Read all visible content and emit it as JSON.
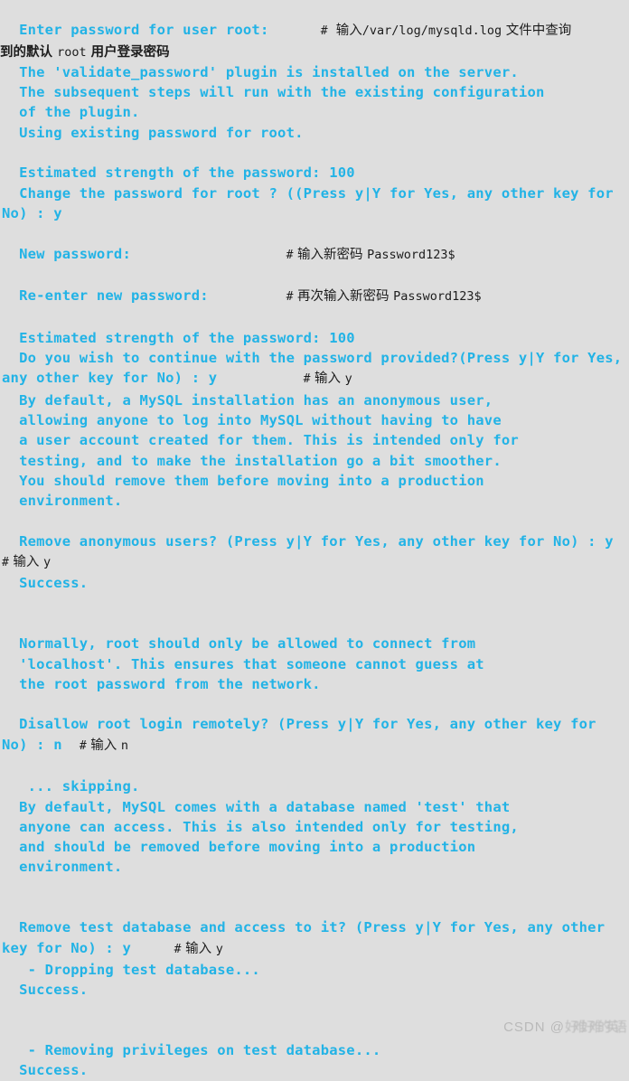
{
  "terminal": {
    "background_color": "#dedede",
    "text_color": "#22b3e6",
    "annotation_color": "#1d1d1d",
    "lines": [
      {
        "id": "l00",
        "type": "blank",
        "text": " "
      },
      {
        "id": "l01",
        "type": "out-note",
        "text": "  Enter password for user root:",
        "note_hash": "#",
        "note_cn": "  输入",
        "note_mono": "/var/log/mysqld.log",
        "note_cn2": " 文件中查询"
      },
      {
        "id": "l02",
        "type": "cn",
        "cn": "到的默认 ",
        "mono": "root",
        "cn2": " 用户登录密码"
      },
      {
        "id": "l03",
        "type": "out",
        "text": "  The 'validate_password' plugin is installed on the server."
      },
      {
        "id": "l04",
        "type": "out",
        "text": "  The subsequent steps will run with the existing configuration"
      },
      {
        "id": "l05",
        "type": "out",
        "text": "  of the plugin."
      },
      {
        "id": "l06",
        "type": "out",
        "text": "  Using existing password for root."
      },
      {
        "id": "l07",
        "type": "blank",
        "text": " "
      },
      {
        "id": "l08",
        "type": "out",
        "text": "  Estimated strength of the password: 100"
      },
      {
        "id": "l09",
        "type": "out",
        "text": "  Change the password for root ? ((Press y|Y for Yes, any other key for No) : y"
      },
      {
        "id": "l10",
        "type": "blank",
        "text": " "
      },
      {
        "id": "l11",
        "type": "out-note",
        "text": "  New password:",
        "note_pad": "                  ",
        "note_hash": "#",
        "note_cn": " 输入新密码 ",
        "note_mono": "Password123$",
        "note_cn2": ""
      },
      {
        "id": "l12",
        "type": "blank",
        "text": " "
      },
      {
        "id": "l13",
        "type": "out-note",
        "text": "  Re-enter new password:",
        "note_pad": "         ",
        "note_hash": "#",
        "note_cn": " 再次输入新密码 ",
        "note_mono": "Password123$",
        "note_cn2": ""
      },
      {
        "id": "l14",
        "type": "blank",
        "text": " "
      },
      {
        "id": "l15",
        "type": "out",
        "text": "  Estimated strength of the password: 100"
      },
      {
        "id": "l16",
        "type": "out-note",
        "text": "  Do you wish to continue with the password provided?(Press y|Y for Yes, any other key for No) : y",
        "note_pad": "          ",
        "note_hash": "#",
        "note_cn": " 输入 ",
        "note_mono": "y",
        "note_cn2": ""
      },
      {
        "id": "l17",
        "type": "out",
        "text": "  By default, a MySQL installation has an anonymous user,"
      },
      {
        "id": "l18",
        "type": "out",
        "text": "  allowing anyone to log into MySQL without having to have"
      },
      {
        "id": "l19",
        "type": "out",
        "text": "  a user account created for them. This is intended only for"
      },
      {
        "id": "l20",
        "type": "out",
        "text": "  testing, and to make the installation go a bit smoother."
      },
      {
        "id": "l21",
        "type": "out",
        "text": "  You should remove them before moving into a production"
      },
      {
        "id": "l22",
        "type": "out",
        "text": "  environment."
      },
      {
        "id": "l23",
        "type": "blank",
        "text": " "
      },
      {
        "id": "l24",
        "type": "out-note",
        "text": "  Remove anonymous users? (Press y|Y for Yes, any other key for No) : y",
        "note_pad": "    ",
        "note_hash": "#",
        "note_cn": " 输入 ",
        "note_mono": "y",
        "note_cn2": ""
      },
      {
        "id": "l25",
        "type": "out",
        "text": "  Success."
      },
      {
        "id": "l26",
        "type": "blank",
        "text": " "
      },
      {
        "id": "l27",
        "type": "blank",
        "text": " "
      },
      {
        "id": "l28",
        "type": "out",
        "text": "  Normally, root should only be allowed to connect from"
      },
      {
        "id": "l29",
        "type": "out",
        "text": "  'localhost'. This ensures that someone cannot guess at"
      },
      {
        "id": "l30",
        "type": "out",
        "text": "  the root password from the network."
      },
      {
        "id": "l31",
        "type": "blank",
        "text": " "
      },
      {
        "id": "l32",
        "type": "out-note",
        "text": "  Disallow root login remotely? (Press y|Y for Yes, any other key for No) : n",
        "note_pad": "  ",
        "note_hash": "#",
        "note_cn": " 输入 ",
        "note_mono": "n",
        "note_cn2": ""
      },
      {
        "id": "l33",
        "type": "blank",
        "text": " "
      },
      {
        "id": "l34",
        "type": "out",
        "text": "   ... skipping."
      },
      {
        "id": "l35",
        "type": "out",
        "text": "  By default, MySQL comes with a database named 'test' that"
      },
      {
        "id": "l36",
        "type": "out",
        "text": "  anyone can access. This is also intended only for testing,"
      },
      {
        "id": "l37",
        "type": "out",
        "text": "  and should be removed before moving into a production"
      },
      {
        "id": "l38",
        "type": "out",
        "text": "  environment."
      },
      {
        "id": "l39",
        "type": "blank",
        "text": " "
      },
      {
        "id": "l40",
        "type": "blank",
        "text": " "
      },
      {
        "id": "l41",
        "type": "out-note",
        "text": "  Remove test database and access to it? (Press y|Y for Yes, any other key for No) : y",
        "note_pad": "     ",
        "note_hash": "#",
        "note_cn": " 输入 ",
        "note_mono": "y",
        "note_cn2": ""
      },
      {
        "id": "l42",
        "type": "out",
        "text": "   - Dropping test database..."
      },
      {
        "id": "l43",
        "type": "out",
        "text": "  Success."
      },
      {
        "id": "l44",
        "type": "blank",
        "text": " "
      },
      {
        "id": "l45",
        "type": "blank",
        "text": " "
      },
      {
        "id": "l46",
        "type": "out",
        "text": "   - Removing privileges on test database..."
      },
      {
        "id": "l47",
        "type": "out",
        "text": "  Success."
      }
    ]
  },
  "watermark": {
    "prefix": "CSDN @",
    "username": "好难好难的英语"
  }
}
